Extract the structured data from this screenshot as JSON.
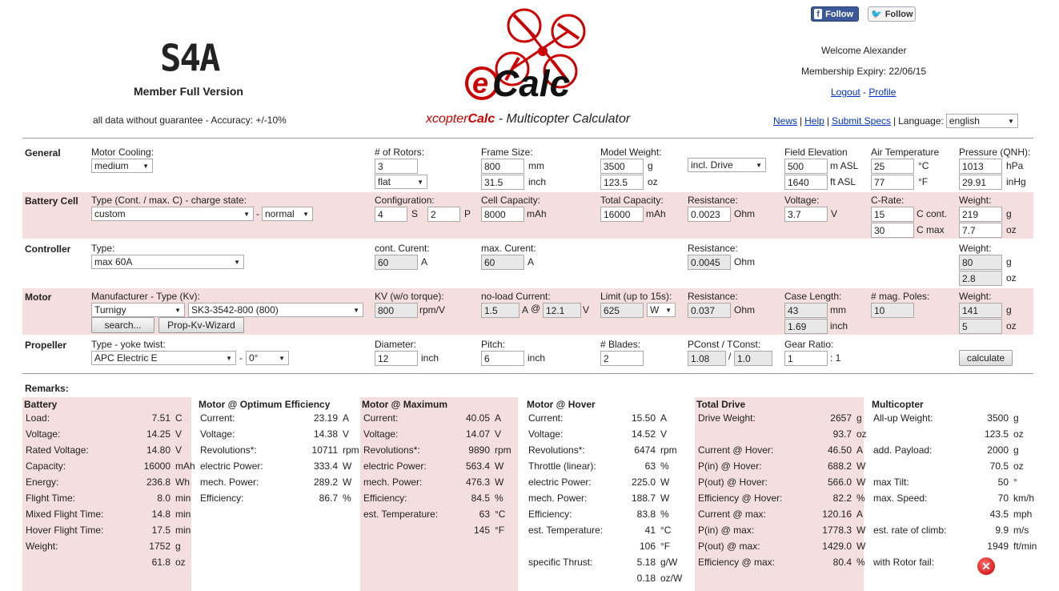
{
  "header": {
    "brand_mark": "S4A",
    "member": "Member Full Version",
    "guarantee": "all data without guarantee - Accuracy: +/-10%",
    "logo_text": "Calc",
    "subtitle_red": "xcopter",
    "subtitle_bold": "Calc",
    "subtitle_rest": " - Multicopter Calculator",
    "facebook": "Follow",
    "twitter": "Follow",
    "welcome": "Welcome Alexander",
    "expiry": "Membership Expiry: 22/06/15",
    "logout": "Logout",
    "sep": " - ",
    "profile": "Profile",
    "nav": [
      "News",
      "Help",
      "Submit Specs"
    ],
    "language_label": "Language:",
    "language": "english"
  },
  "general": {
    "title": "General",
    "motor_cooling_label": "Motor Cooling:",
    "motor_cooling": "medium",
    "rotors_label": "# of Rotors:",
    "rotors": "3",
    "rotor_layout": "flat",
    "frame_label": "Frame Size:",
    "frame_mm": "800",
    "frame_inch": "31.5",
    "model_weight_label": "Model Weight:",
    "weight_g": "3500",
    "weight_oz": "123.5",
    "weight_mode": "incl. Drive",
    "elev_label": "Field Elevation",
    "elev_m": "500",
    "elev_ft": "1640",
    "temp_label": "Air Temperature",
    "temp_c": "25",
    "temp_f": "77",
    "press_label": "Pressure (QNH):",
    "press_hpa": "1013",
    "press_inhg": "29.91",
    "u_mm": "mm",
    "u_inch": "inch",
    "u_g": "g",
    "u_oz": "oz",
    "u_masl": "m ASL",
    "u_ftasl": "ft ASL",
    "u_c": "°C",
    "u_f": "°F",
    "u_hpa": "hPa",
    "u_inhg": "inHg"
  },
  "battery": {
    "title": "Battery Cell",
    "type_label": "Type (Cont. / max. C) - charge state:",
    "type": "custom",
    "dash": "-",
    "charge": "normal",
    "config_label": "Configuration:",
    "s": "4",
    "s_u": "S",
    "p": "2",
    "p_u": "P",
    "cap_label": "Cell Capacity:",
    "cap": "8000",
    "cap_u": "mAh",
    "tcap_label": "Total Capacity:",
    "tcap": "16000",
    "tcap_u": "mAh",
    "res_label": "Resistance:",
    "res": "0.0023",
    "res_u": "Ohm",
    "volt_label": "Voltage:",
    "volt": "3.7",
    "volt_u": "V",
    "crate_label": "C-Rate:",
    "c_cont": "15",
    "c_cont_u": "C cont.",
    "c_max": "30",
    "c_max_u": "C max",
    "wt_label": "Weight:",
    "wt_g": "219",
    "wt_oz": "7.7",
    "g": "g",
    "oz": "oz"
  },
  "controller": {
    "title": "Controller",
    "type_label": "Type:",
    "type": "max 60A",
    "cont_label": "cont. Curent:",
    "cont": "60",
    "cont_u": "A",
    "max_label": "max. Curent:",
    "max": "60",
    "max_u": "A",
    "res_label": "Resistance:",
    "res": "0.0045",
    "res_u": "Ohm",
    "wt_label": "Weight:",
    "wt_g": "80",
    "wt_oz": "2.8",
    "g": "g",
    "oz": "oz"
  },
  "motor": {
    "title": "Motor",
    "mfr_label": "Manufacturer - Type (Kv):",
    "mfr": "Turnigy",
    "type": "SK3-3542-800 (800)",
    "search": "search...",
    "wizard": "Prop-Kv-Wizard",
    "kv_label": "KV (w/o torque):",
    "kv": "800",
    "kv_u": "rpm/V",
    "noload_label": "no-load Current:",
    "noload": "1.5",
    "noload_u": "A",
    "at": "@",
    "noload_v": "12.1",
    "v": "V",
    "limit_label": "Limit (up to 15s):",
    "limit": "625",
    "limit_u": "W",
    "res_label": "Resistance:",
    "res": "0.037",
    "res_u": "Ohm",
    "case_label": "Case Length:",
    "case_mm": "43",
    "case_inch": "1.69",
    "mm": "mm",
    "inch": "inch",
    "poles_label": "# mag. Poles:",
    "poles": "10",
    "wt_label": "Weight:",
    "wt_g": "141",
    "wt_oz": "5",
    "g": "g",
    "oz": "oz"
  },
  "propeller": {
    "title": "Propeller",
    "type_label": "Type - yoke twist:",
    "type": "APC Electric E",
    "dash": "-",
    "twist": "0°",
    "dia_label": "Diameter:",
    "dia": "12",
    "dia_u": "inch",
    "pitch_label": "Pitch:",
    "pitch": "6",
    "pitch_u": "inch",
    "blades_label": "# Blades:",
    "blades": "2",
    "pconst_label": "PConst / TConst:",
    "pconst": "1.08",
    "slash": "/",
    "tconst": "1.0",
    "gear_label": "Gear Ratio:",
    "gear": "1",
    "gear_u": ": 1",
    "calculate": "calculate"
  },
  "remarks": {
    "title": "Remarks:",
    "columns": [
      {
        "title": "Battery",
        "rows": [
          [
            "Load:",
            "7.51",
            "C"
          ],
          [
            "Voltage:",
            "14.25",
            "V"
          ],
          [
            "Rated Voltage:",
            "14.80",
            "V"
          ],
          [
            "Capacity:",
            "16000",
            "mAh"
          ],
          [
            "Energy:",
            "236.8",
            "Wh"
          ],
          [
            "Flight Time:",
            "8.0",
            "min"
          ],
          [
            "Mixed Flight Time:",
            "14.8",
            "min"
          ],
          [
            "Hover Flight Time:",
            "17.5",
            "min"
          ],
          [
            "Weight:",
            "1752",
            "g"
          ],
          [
            "",
            "61.8",
            "oz"
          ]
        ]
      },
      {
        "title": "Motor @ Optimum Efficiency",
        "rows": [
          [
            "Current:",
            "23.19",
            "A"
          ],
          [
            "Voltage:",
            "14.38",
            "V"
          ],
          [
            "Revolutions*:",
            "10711",
            "rpm"
          ],
          [
            "electric Power:",
            "333.4",
            "W"
          ],
          [
            "mech. Power:",
            "289.2",
            "W"
          ],
          [
            "Efficiency:",
            "86.7",
            "%"
          ]
        ]
      },
      {
        "title": "Motor @ Maximum",
        "rows": [
          [
            "Current:",
            "40.05",
            "A"
          ],
          [
            "Voltage:",
            "14.07",
            "V"
          ],
          [
            "Revolutions*:",
            "9890",
            "rpm"
          ],
          [
            "electric Power:",
            "563.4",
            "W"
          ],
          [
            "mech. Power:",
            "476.3",
            "W"
          ],
          [
            "Efficiency:",
            "84.5",
            "%"
          ],
          [
            "est. Temperature:",
            "63",
            "°C"
          ],
          [
            "",
            "145",
            "°F"
          ]
        ]
      },
      {
        "title": "Motor @ Hover",
        "rows": [
          [
            "Current:",
            "15.50",
            "A"
          ],
          [
            "Voltage:",
            "14.52",
            "V"
          ],
          [
            "Revolutions*:",
            "6474",
            "rpm"
          ],
          [
            "Throttle (linear):",
            "63",
            "%"
          ],
          [
            "electric Power:",
            "225.0",
            "W"
          ],
          [
            "mech. Power:",
            "188.7",
            "W"
          ],
          [
            "Efficiency:",
            "83.8",
            "%"
          ],
          [
            "est. Temperature:",
            "41",
            "°C"
          ],
          [
            "",
            "106",
            "°F"
          ],
          [
            "specific Thrust:",
            "5.18",
            "g/W"
          ],
          [
            "",
            "0.18",
            "oz/W"
          ]
        ]
      },
      {
        "title": "Total Drive",
        "rows": [
          [
            "Drive Weight:",
            "2657",
            "g"
          ],
          [
            "",
            "93.7",
            "oz"
          ],
          [
            "Current @ Hover:",
            "46.50",
            "A"
          ],
          [
            "P(in) @ Hover:",
            "688.2",
            "W"
          ],
          [
            "P(out) @ Hover:",
            "566.0",
            "W"
          ],
          [
            "Efficiency @ Hover:",
            "82.2",
            "%"
          ],
          [
            "Current @ max:",
            "120.16",
            "A"
          ],
          [
            "P(in) @ max:",
            "1778.3",
            "W"
          ],
          [
            "P(out) @ max:",
            "1429.0",
            "W"
          ],
          [
            "Efficiency @ max:",
            "80.4",
            "%"
          ]
        ]
      },
      {
        "title": "Multicopter",
        "rows": [
          [
            "All-up Weight:",
            "3500",
            "g"
          ],
          [
            "",
            "123.5",
            "oz"
          ],
          [
            "add. Payload:",
            "2000",
            "g"
          ],
          [
            "",
            "70.5",
            "oz"
          ],
          [
            "max Tilt:",
            "50",
            "°"
          ],
          [
            "max. Speed:",
            "70",
            "km/h"
          ],
          [
            "",
            "43.5",
            "mph"
          ],
          [
            "est. rate of climb:",
            "9.9",
            "m/s"
          ],
          [
            "",
            "1949",
            "ft/min"
          ],
          [
            "with Rotor fail:",
            "",
            ""
          ]
        ]
      }
    ]
  },
  "colors": {
    "pink": "#f5dede",
    "red": "#cc0000",
    "link": "#0033cc"
  },
  "icons": {
    "rotor_fail": "x-circle-icon"
  }
}
